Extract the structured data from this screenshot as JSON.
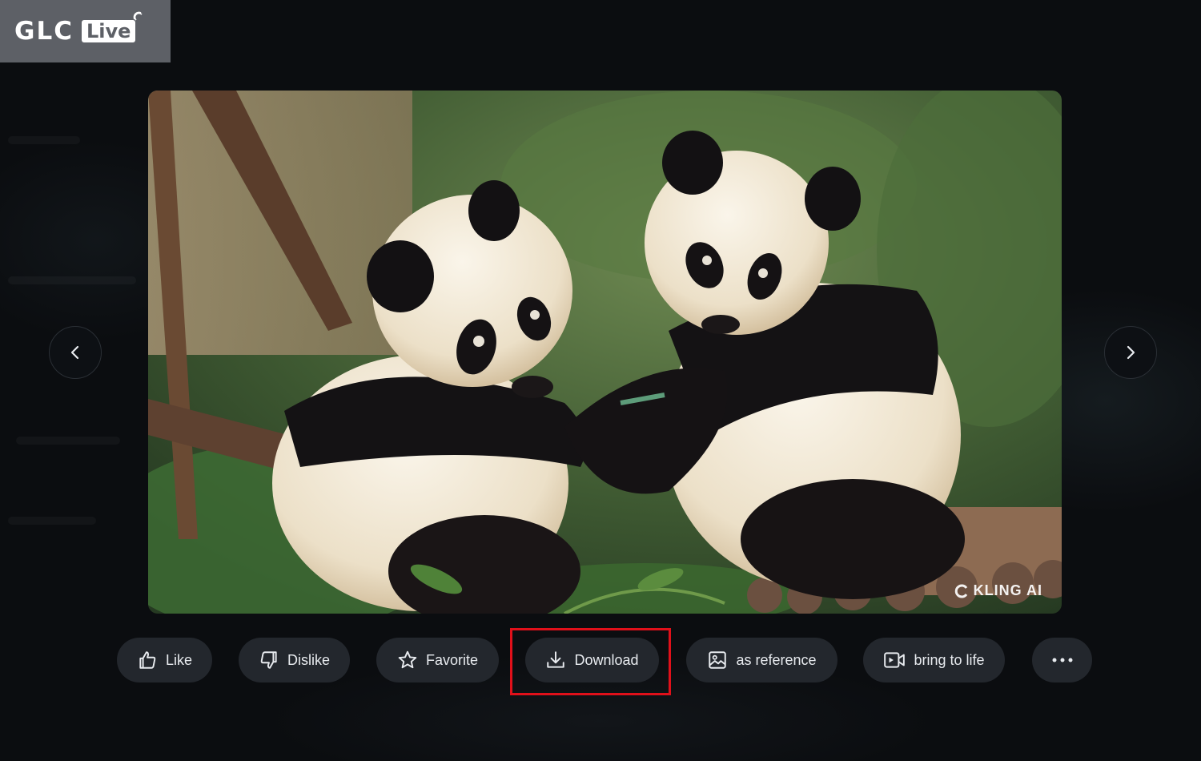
{
  "logo": {
    "glc": "GLC",
    "live": "Live"
  },
  "viewer": {
    "image_watermark": "KLING AI",
    "prev_icon": "chevron-left-icon",
    "next_icon": "chevron-right-icon"
  },
  "actions": [
    {
      "label": "Like",
      "icon": "thumbs-up-icon"
    },
    {
      "label": "Dislike",
      "icon": "thumbs-down-icon"
    },
    {
      "label": "Favorite",
      "icon": "star-icon"
    },
    {
      "label": "Download",
      "icon": "download-icon"
    },
    {
      "label": "as reference",
      "icon": "image-icon"
    },
    {
      "label": "bring to life",
      "icon": "video-icon"
    }
  ],
  "more_icon": "more-horizontal-icon",
  "colors": {
    "accent_highlight": "#e0101a",
    "button_bg": "#23272d",
    "page_bg": "#0b0d10"
  }
}
